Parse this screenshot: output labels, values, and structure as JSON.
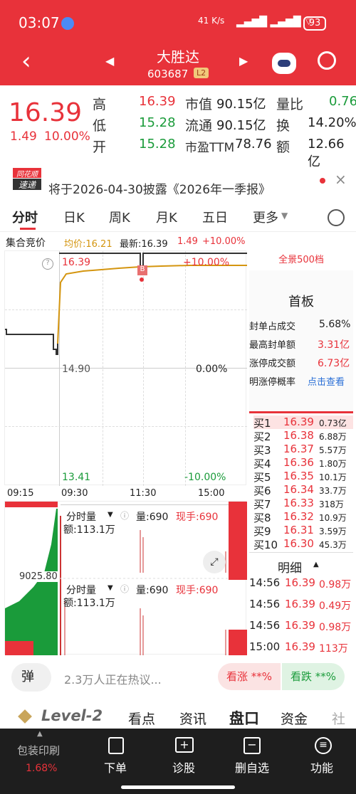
{
  "status": {
    "time": "03:07",
    "net": "41 K/s",
    "battery": "93"
  },
  "nav": {
    "title": "大胜达",
    "code": "603687",
    "badge": "L2"
  },
  "quote": {
    "price": "16.39",
    "change": "1.49",
    "pct": "10.00%",
    "high_label": "高",
    "high": "16.39",
    "low_label": "低",
    "low": "15.28",
    "open_label": "开",
    "open": "15.28",
    "mcap_label": "市值",
    "mcap": "90.15亿",
    "float_label": "流通",
    "float": "90.15亿",
    "pe_label": "市盈TTM",
    "pe": "78.76",
    "vr_label": "量比",
    "vr": "0.76",
    "turn_label": "换",
    "turn": "14.20%",
    "amt_label": "额",
    "amt": "12.66亿"
  },
  "notice": {
    "logo_top": "同花顺",
    "logo_bottom": "速递",
    "text": "将于2026-04-30披露《2026年一季报》"
  },
  "tabs": [
    "分时",
    "日K",
    "周K",
    "月K",
    "五日",
    "更多"
  ],
  "info": {
    "auction": "集合竞价",
    "avg": "均价:16.21",
    "latest": "最新:16.39",
    "chg": "1.49",
    "pct": "+10.00%"
  },
  "chart_data": {
    "type": "line",
    "top_price": "16.39",
    "top_pct": "+10.00%",
    "mid_price": "14.90",
    "mid_pct": "0.00%",
    "bot_price": "13.41",
    "bot_pct": "-10.00%",
    "x_ticks": [
      "09:15",
      "09:30",
      "11:30",
      "15:00"
    ],
    "marker": "B"
  },
  "panel": {
    "full": "全景500档",
    "board": "首板",
    "rows": [
      {
        "k": "封单占成交",
        "v": "5.68%"
      },
      {
        "k": "最高封单额",
        "v": "3.31亿"
      },
      {
        "k": "涨停成交额",
        "v": "6.73亿"
      },
      {
        "k": "明涨停概率",
        "v": "点击查看"
      }
    ]
  },
  "bids": [
    [
      "买1",
      "16.39",
      "0.73亿"
    ],
    [
      "买2",
      "16.38",
      "6.88万"
    ],
    [
      "买3",
      "16.37",
      "5.57万"
    ],
    [
      "买4",
      "16.36",
      "1.80万"
    ],
    [
      "买5",
      "16.35",
      "10.1万"
    ],
    [
      "买6",
      "16.34",
      "33.7万"
    ],
    [
      "买7",
      "16.33",
      "318万"
    ],
    [
      "买8",
      "16.32",
      "10.9万"
    ],
    [
      "买9",
      "16.31",
      "3.59万"
    ],
    [
      "买10",
      "16.30",
      "45.3万"
    ]
  ],
  "detail": {
    "title": "明细",
    "rows": [
      [
        "14:56",
        "16.39",
        "0.98万"
      ],
      [
        "14:56",
        "16.39",
        "0.49万"
      ],
      [
        "14:56",
        "16.39",
        "0.98万"
      ],
      [
        "15:00",
        "16.39",
        "113万"
      ]
    ]
  },
  "volume": {
    "label": "分时量",
    "qty": "量:690",
    "hand": "现手:690",
    "amt": "额:113.1万",
    "axis": "9025.80"
  },
  "hot": {
    "danmu": "弹",
    "text": "2.3万人正在热议...",
    "up": "看涨 **%",
    "down": "看跌 **%"
  },
  "bottom_tabs": [
    "Level-2",
    "看点",
    "资讯",
    "盘口",
    "资金",
    "社区"
  ],
  "dock": [
    {
      "label": "包装印刷",
      "sub": "1.68%"
    },
    {
      "label": "下单"
    },
    {
      "label": "诊股"
    },
    {
      "label": "删自选"
    },
    {
      "label": "功能"
    }
  ]
}
